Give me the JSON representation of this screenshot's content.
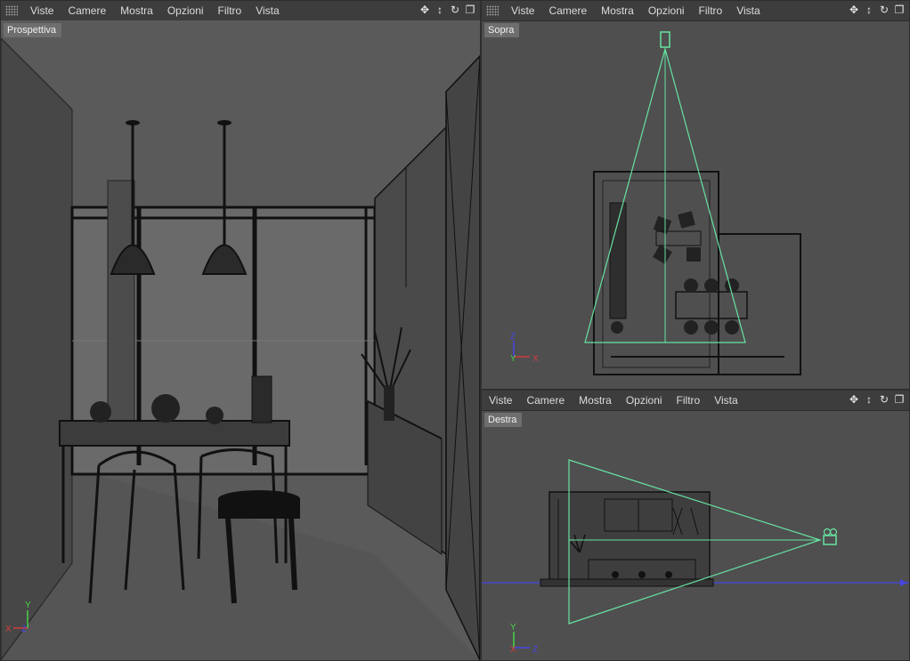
{
  "menu": [
    "Viste",
    "Camere",
    "Mostra",
    "Opzioni",
    "Filtro",
    "Vista"
  ],
  "nav_icons": [
    "move-icon",
    "zoom-arrows-icon",
    "rotate-icon",
    "maximize-icon"
  ],
  "viewports": {
    "perspective": {
      "label": "Prospettiva"
    },
    "top": {
      "label": "Sopra"
    },
    "right": {
      "label": "Destra"
    }
  },
  "axes": {
    "x": "X",
    "y": "Y",
    "z": "Z"
  },
  "colors": {
    "camera": "#66e3a0",
    "axis_x": "#d23c3c",
    "axis_y": "#46d246",
    "axis_z": "#4646e6",
    "wire": "#111111",
    "bg": "#4f4f4f"
  }
}
